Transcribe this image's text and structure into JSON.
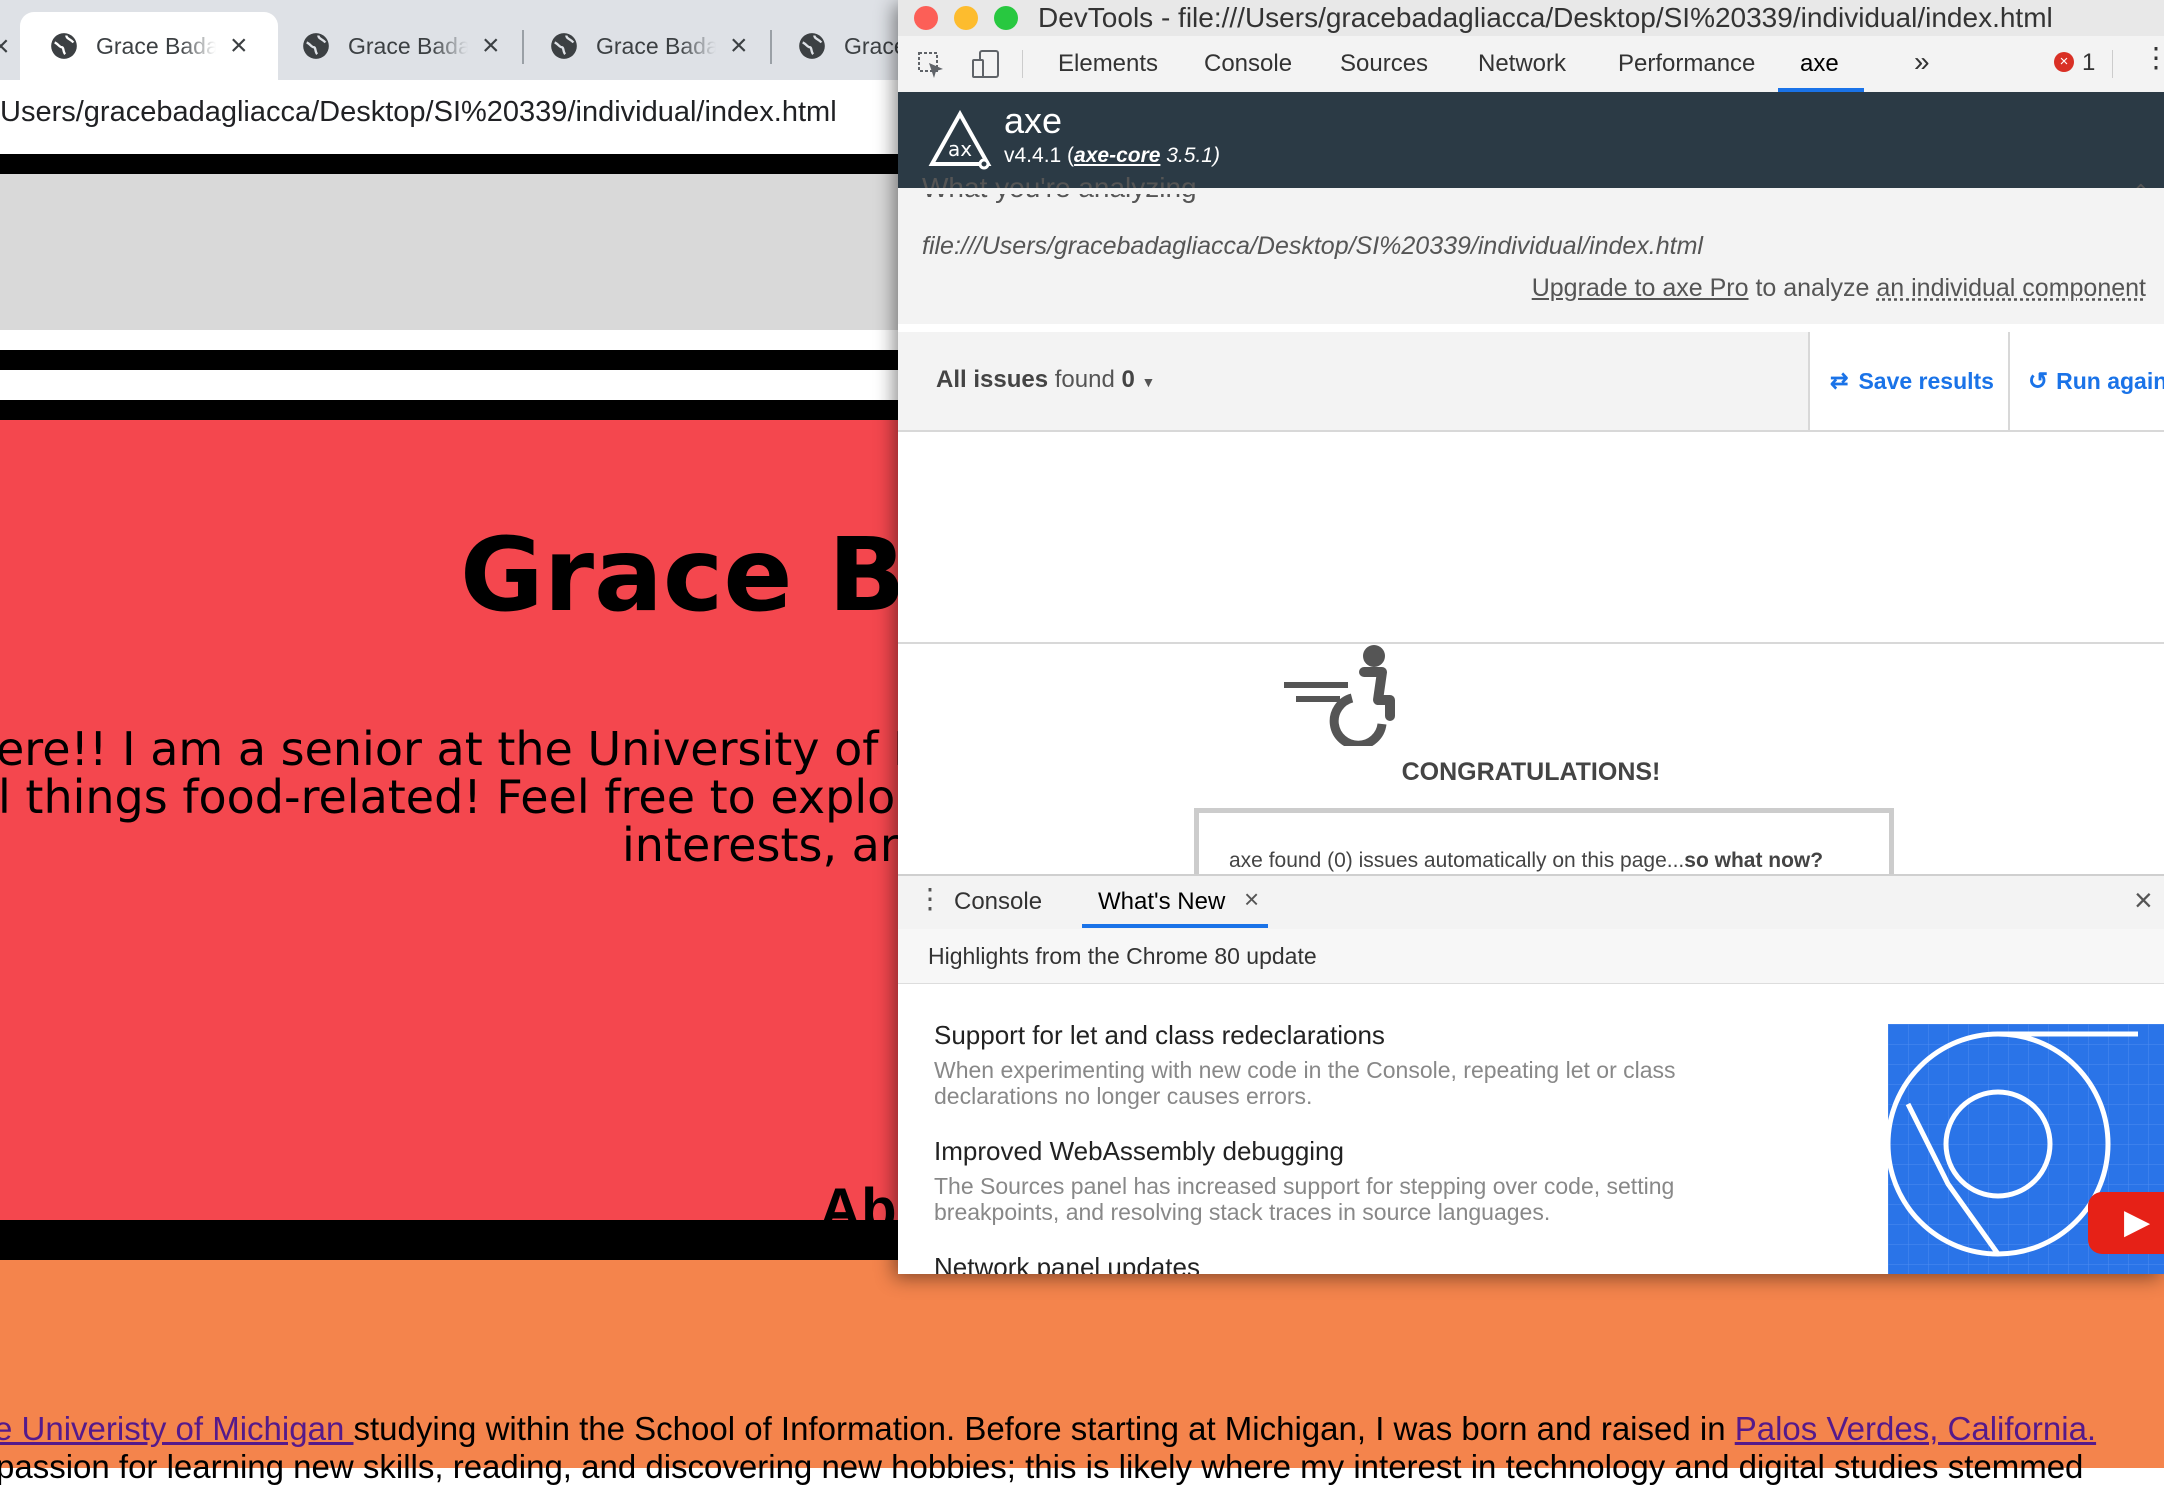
{
  "browser": {
    "tabs": [
      {
        "label": "Grace Badagliacca",
        "active": true
      },
      {
        "label": "Grace Badagliacca",
        "active": false
      },
      {
        "label": "Grace Badagliacca",
        "active": false
      },
      {
        "label": "Grace Badagliacca",
        "active": false
      }
    ],
    "address": "Users/gracebadagliacca/Desktop/SI%20339/individual/index.html"
  },
  "page": {
    "hero_title": "Grace Ba",
    "hero_lines": [
      "ere!! I am a senior at the University of M",
      "l things food-related! Feel free to explo",
      "interests, ar"
    ],
    "about_title": "About",
    "about_link1": "e Univeristy of Michigan ",
    "about_text1": "studying within the School of Information. Before starting at Michigan, I was born and raised in ",
    "about_link2": "Palos Verdes, California.",
    "about_text2": "passion for learning new skills, reading, and discovering new hobbies; this is likely where my interest in technology and digital studies stemmed"
  },
  "devtools": {
    "title": "DevTools - file:///Users/gracebadagliacca/Desktop/SI%20339/individual/index.html",
    "tabs": [
      "Elements",
      "Console",
      "Sources",
      "Network",
      "Performance",
      "axe"
    ],
    "more": "»",
    "error_count": "1",
    "axe": {
      "name": "axe",
      "version": "v4.4.1 (",
      "core_link": "axe-core",
      "core_version": " 3.5.1)",
      "analyzing_label": "What you're analyzing",
      "analyzing_url": "file:///Users/gracebadagliacca/Desktop/SI%20339/individual/index.html",
      "upgrade_link": "Upgrade to axe Pro",
      "upgrade_mid": " to analyze ",
      "upgrade_component": "an individual component",
      "issues_label": "All issues",
      "issues_found": " found ",
      "issues_count": "0",
      "save_results": "Save results",
      "run_again": "Run again",
      "congrats": "CONGRATULATIONS!",
      "found_text": "axe found (0) issues automatically on this page...",
      "found_bold": "so what now?"
    },
    "drawer": {
      "tabs": [
        "Console",
        "What's New"
      ],
      "highlights": "Highlights from the Chrome 80 update",
      "features": [
        {
          "title": "Support for let and class redeclarations",
          "desc": "When experimenting with new code in the Console, repeating let or class declarations no longer causes errors."
        },
        {
          "title": "Improved WebAssembly debugging",
          "desc": "The Sources panel has increased support for stepping over code, setting breakpoints, and resolving stack traces in source languages."
        },
        {
          "title": "Network panel updates",
          "desc": ""
        }
      ]
    }
  },
  "colors": {
    "hero_bg": "#f4474e",
    "about_bg": "#f4844c",
    "gray_band": "#d9d9d9",
    "axe_header": "#2b3a45",
    "accent": "#1a73e8"
  }
}
